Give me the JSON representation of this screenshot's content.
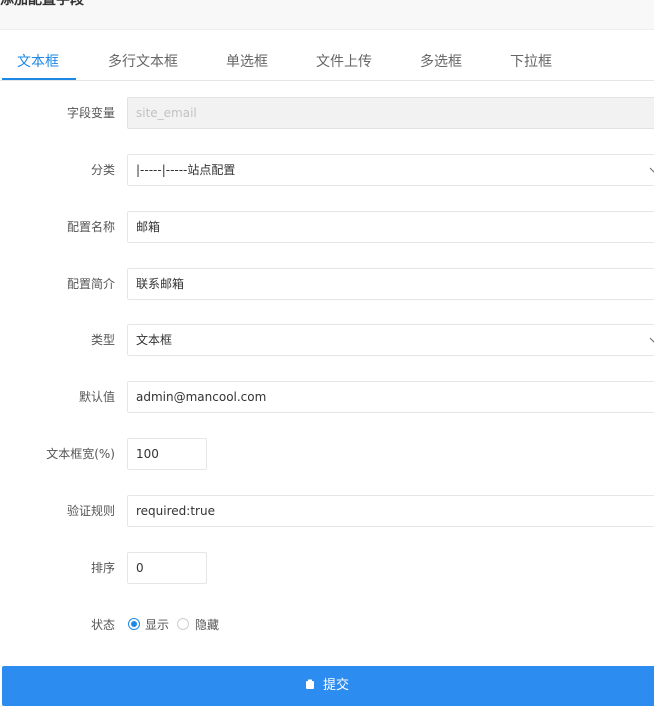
{
  "header": {
    "title": "添加配置字段"
  },
  "tabs": [
    {
      "label": "文本框",
      "active": true
    },
    {
      "label": "多行文本框"
    },
    {
      "label": "单选框"
    },
    {
      "label": "文件上传"
    },
    {
      "label": "多选框"
    },
    {
      "label": "下拉框"
    }
  ],
  "form": {
    "variable": {
      "label": "字段变量",
      "placeholder": "site_email"
    },
    "category": {
      "label": "分类",
      "value": "|-----|-----站点配置"
    },
    "name": {
      "label": "配置名称",
      "value": "邮箱"
    },
    "intro": {
      "label": "配置简介",
      "value": "联系邮箱"
    },
    "type": {
      "label": "类型",
      "value": "文本框"
    },
    "default": {
      "label": "默认值",
      "value": "admin@mancool.com"
    },
    "width": {
      "label": "文本框宽(%)",
      "value": "100"
    },
    "rule": {
      "label": "验证规则",
      "value": "required:true"
    },
    "sort": {
      "label": "排序",
      "value": "0"
    },
    "status": {
      "label": "状态",
      "options": [
        {
          "label": "显示",
          "checked": true
        },
        {
          "label": "隐藏",
          "checked": false
        }
      ]
    }
  },
  "submit": {
    "label": "提交",
    "icon": "save-icon"
  },
  "colors": {
    "accent": "#1e88e5",
    "button": "#2d8cf0"
  }
}
